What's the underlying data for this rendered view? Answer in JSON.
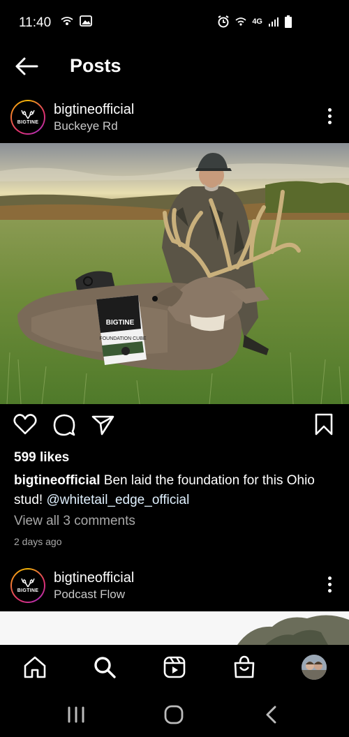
{
  "status_bar": {
    "time": "11:40",
    "network": "4G"
  },
  "header": {
    "title": "Posts",
    "back_icon": "arrow-left-icon"
  },
  "posts": [
    {
      "username": "bigtineofficial",
      "location": "Buckeye Rd",
      "avatar_text": "BIGTINE",
      "image_product_brand": "BIGTINE",
      "image_product_name": "FOUNDATION CUBE",
      "likes": "599 likes",
      "caption_user": "bigtineofficial",
      "caption_text": " Ben laid the foundation for this Ohio stud!  ",
      "caption_mention": "@whitetail_edge_official",
      "view_comments": "View all 3 comments",
      "timestamp": "2 days ago"
    },
    {
      "username": "bigtineofficial",
      "location": "Podcast Flow",
      "avatar_text": "BIGTINE"
    }
  ],
  "bottom_nav": {
    "items": [
      "home-icon",
      "search-icon",
      "reels-icon",
      "shop-icon",
      "profile-avatar"
    ]
  },
  "system_nav": {
    "items": [
      "recents-icon",
      "home-circle-icon",
      "back-chevron-icon"
    ]
  },
  "colors": {
    "background": "#000000",
    "text": "#ffffff",
    "secondary_text": "#a8a8a8",
    "mention": "#e0f1ff"
  }
}
